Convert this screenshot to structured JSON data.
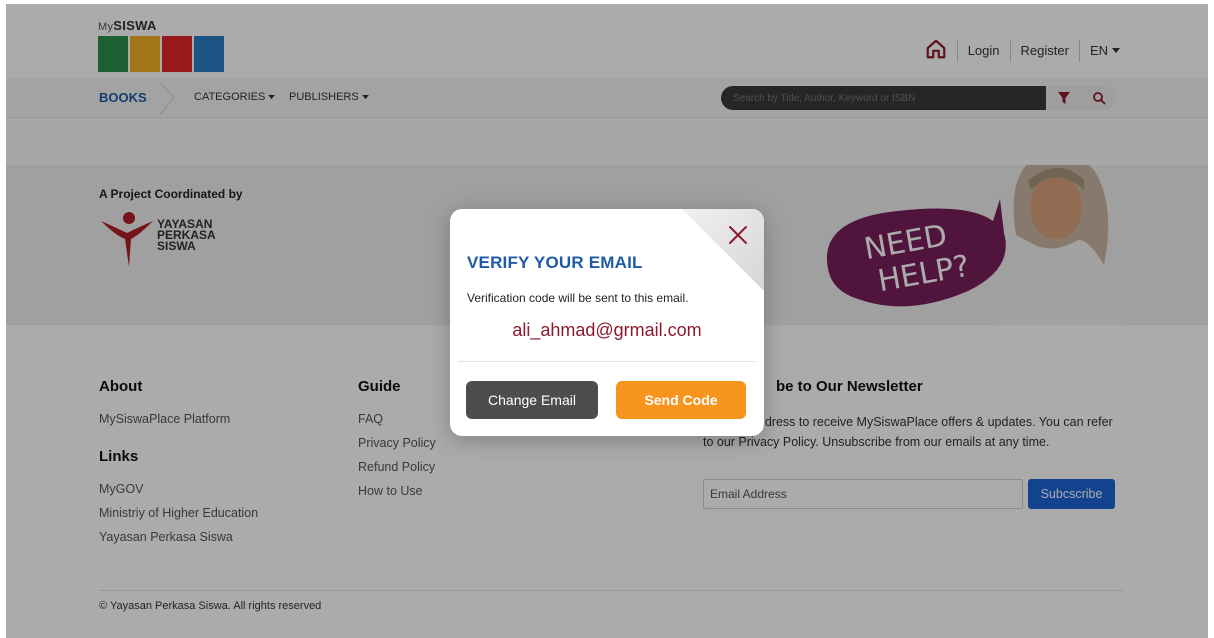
{
  "header": {
    "logo_small_prefix": "My",
    "logo_small": "SISWA",
    "login": "Login",
    "register": "Register",
    "language": "EN",
    "icons": [
      "home-icon",
      "caret-down-icon"
    ]
  },
  "nav": {
    "books": "BOOKS",
    "categories": "CATEGORIES",
    "publishers": "PUBLISHERS",
    "search_placeholder": "Search by Title, Author, Keyword or ISBN",
    "icons": [
      "filter-icon",
      "search-icon"
    ]
  },
  "banner": {
    "project_label": "A Project Coordinated by",
    "org_lines": [
      "YAYASAN",
      "PERKASA",
      "SISWA"
    ],
    "help_text": [
      "NEED",
      "HELP?"
    ]
  },
  "footer": {
    "about_heading": "About",
    "about_links": [
      "MySiswaPlace Platform"
    ],
    "links_heading": "Links",
    "links": [
      "MyGOV",
      "Ministriy of Higher Education",
      "Yayasan Perkasa Siswa"
    ],
    "guide_heading": "Guide",
    "guide_links": [
      "FAQ",
      "Privacy Policy",
      "Refund Policy",
      "How to Use"
    ],
    "newsletter_heading": "be to Our Newsletter",
    "newsletter_text": "ur email address to receive MySiswaPlace offers & updates. You can refer to our Privacy Policy. Unsubscribe from our emails at any time.",
    "email_placeholder": "Email Address",
    "subscribe_label": "Subcscribe",
    "copyright": "© Yayasan Perkasa Siswa. All rights reserved"
  },
  "modal": {
    "title": "VERIFY YOUR EMAIL",
    "description": "Verification code will be sent to this email.",
    "email": "ali_ahmad@grmail.com",
    "change_email_label": "Change Email",
    "send_code_label": "Send Code",
    "icons": [
      "close-icon"
    ]
  },
  "colors": {
    "brand_blue": "#1f5aa6",
    "accent_orange": "#f7941d",
    "email_red": "#8c1b2f",
    "subscribe_blue": "#1d63d6",
    "help_purple": "#7a1f5c"
  }
}
